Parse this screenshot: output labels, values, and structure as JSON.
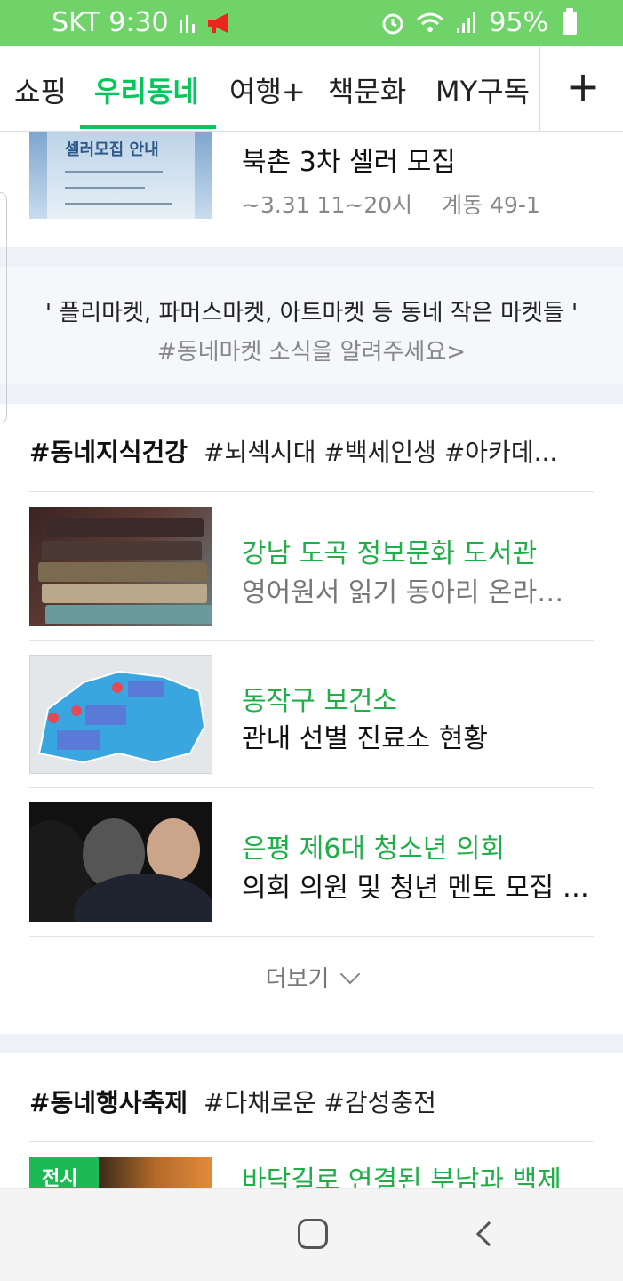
{
  "status_bar": {
    "carrier_time": "SKT 9:30",
    "battery": "95%"
  },
  "tabs": [
    {
      "label": "쇼핑"
    },
    {
      "label": "우리동네"
    },
    {
      "label": "여행+"
    },
    {
      "label": "책문화"
    },
    {
      "label": "MY구독"
    }
  ],
  "add_tab_label": "+",
  "first_card": {
    "image_text": "셀러모집 안내",
    "title": "북촌 3차 셀러 모집",
    "date": "~3.31 11~20시",
    "location": "계동 49-1"
  },
  "banner": {
    "line1": "' 플리마켓, 파머스마켓, 아트마켓 등 동네 작은 마켓들 '",
    "line2": "#동네마켓 소식을 알려주세요>"
  },
  "section1": {
    "title": "#동네지식건강",
    "tags": "#뇌섹시대 #백세인생 #아카데...",
    "items": [
      {
        "title": "강남 도곡 정보문화 도서관",
        "subtitle": "영어원서 읽기 동아리 온라…"
      },
      {
        "title": "동작구 보건소",
        "subtitle": "관내 선별 진료소 현황"
      },
      {
        "title": "은평 제6대 청소년 의회",
        "subtitle": "의회 의원 및 청년 멘토 모집 …"
      }
    ],
    "more_label": "더보기"
  },
  "section2": {
    "title": "#동네행사축제",
    "tags": "#다채로운 #감성충전",
    "items": [
      {
        "badge": "전시",
        "title": "바닥길로 연결된 부남과 백제"
      }
    ]
  }
}
